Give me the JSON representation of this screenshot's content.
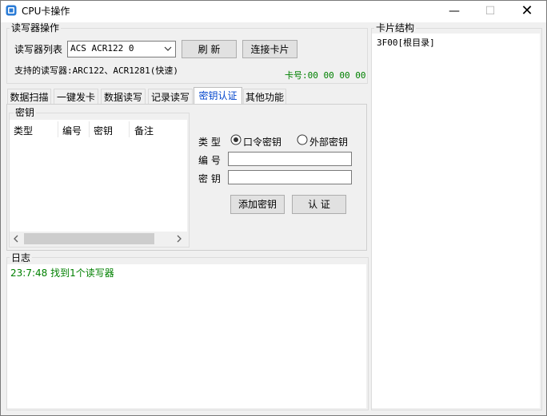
{
  "window": {
    "title": "CPU卡操作",
    "minimize": "—",
    "maximize": "☐",
    "close": "✕"
  },
  "reader_ops": {
    "group_label": "读写器操作",
    "list_label": "读写器列表",
    "reader_selected": "ACS ACR122 0",
    "refresh_button": "刷 新",
    "connect_button": "连接卡片",
    "supported_text": "支持的读写器:ARC122、ACR1281(快速)",
    "card_no": "卡号:00 00 00 00"
  },
  "tabs": [
    {
      "label": "数据扫描"
    },
    {
      "label": "一键发卡"
    },
    {
      "label": "数据读写"
    },
    {
      "label": "记录读写"
    },
    {
      "label": "密钥认证"
    },
    {
      "label": "其他功能"
    }
  ],
  "key_panel": {
    "group_label": "密钥",
    "columns": [
      "类型",
      "编号",
      "密钥",
      "备注"
    ],
    "type_label": "类 型",
    "radio_internal": "口令密钥",
    "radio_external": "外部密钥",
    "number_label": "编 号",
    "key_label": "密 钥",
    "number_value": "",
    "key_value": "",
    "add_button": "添加密钥",
    "auth_button": "认 证",
    "selected_type": "口令密钥"
  },
  "log": {
    "group_label": "日志",
    "lines": [
      "23:7:48 找到1个读写器"
    ],
    "color": "#008000"
  },
  "card_structure": {
    "group_label": "卡片结构",
    "root_node": "3F00[根目录]"
  },
  "colors": {
    "accent": "#0044cc",
    "card_no": "#008000"
  }
}
